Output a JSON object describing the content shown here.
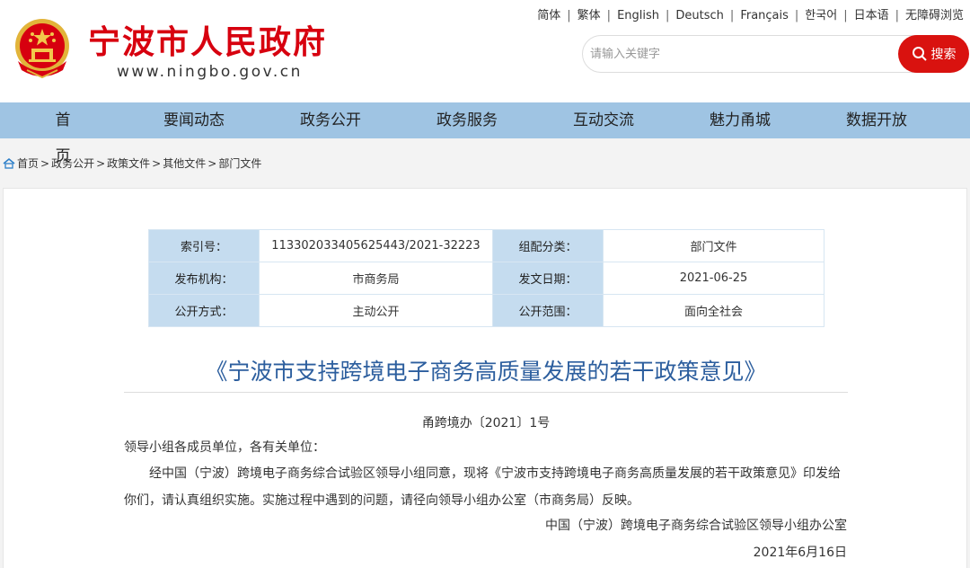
{
  "header": {
    "site_title": "宁波市人民政府",
    "site_url": "www.ningbo.gov.cn",
    "languages": [
      "简体",
      "繁体",
      "English",
      "Deutsch",
      "Français",
      "한국어",
      "日本语",
      "无障碍浏览"
    ],
    "search": {
      "placeholder": "请输入关键字",
      "button_label": "搜索"
    }
  },
  "nav": {
    "items": [
      "首 页",
      "要闻动态",
      "政务公开",
      "政务服务",
      "互动交流",
      "魅力甬城",
      "数据开放"
    ]
  },
  "breadcrumb": [
    "首页",
    "政务公开",
    "政策文件",
    "其他文件",
    "部门文件"
  ],
  "breadcrumb_separator": ">",
  "meta": {
    "rows": [
      [
        "索引号：",
        "113302033405625443/2021-32223",
        "组配分类：",
        "部门文件"
      ],
      [
        "发布机构：",
        "市商务局",
        "发文日期：",
        "2021-06-25"
      ],
      [
        "公开方式：",
        "主动公开",
        "公开范围：",
        "面向全社会"
      ]
    ]
  },
  "document": {
    "title": "《宁波市支持跨境电子商务高质量发展的若干政策意见》",
    "number": "甬跨境办〔2021〕1号",
    "salutation": "领导小组各成员单位，各有关单位：",
    "body": "经中国（宁波）跨境电子商务综合试验区领导小组同意，现将《宁波市支持跨境电子商务高质量发展的若干政策意见》印发给你们，请认真组织实施。实施过程中遇到的问题，请径向领导小组办公室（市商务局）反映。",
    "sign_org": "中国（宁波）跨境电子商务综合试验区领导小组办公室",
    "sign_date": "2021年6月16日"
  },
  "colors": {
    "brand_red": "#d7000f",
    "nav_bg": "#9fc4e3",
    "title_blue": "#2c5e9e",
    "meta_key_bg": "#c5dcef"
  }
}
